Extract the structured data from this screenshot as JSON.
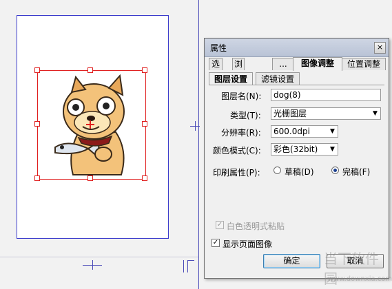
{
  "dialog": {
    "title": "属性",
    "close_symbol": "×",
    "tabs": [
      {
        "label": "选"
      },
      {
        "label": "浏"
      },
      {
        "label": "..."
      },
      {
        "label": "图像调整"
      },
      {
        "label": "位置调整"
      }
    ],
    "subtabs": [
      {
        "label": "图层设置"
      },
      {
        "label": "滤镜设置"
      }
    ],
    "fields": {
      "layer_name_label": "图层名(N):",
      "layer_name_value": "dog(8)",
      "type_label": "类型(T):",
      "type_value": "光栅图层",
      "resolution_label": "分辨率(R):",
      "resolution_value": "600.0dpi",
      "color_mode_label": "颜色模式(C):",
      "color_mode_value": "彩色(32bit)",
      "print_label": "印刷属性(P):",
      "print_option_draft": "草稿(D)",
      "print_option_final": "完稿(F)",
      "print_selected": "完稿(F)"
    },
    "checkboxes": {
      "white_transparent_label": "白色透明式粘贴",
      "white_transparent_checked": true,
      "white_transparent_enabled": false,
      "show_page_image_label": "显示页面图像",
      "show_page_image_checked": true
    },
    "buttons": {
      "ok": "确定",
      "cancel": "取消"
    }
  },
  "watermark": {
    "text": "当下软件园",
    "url": "www.downxia.com"
  },
  "colors": {
    "selection": "#e02020",
    "page_border": "#3c3ccc",
    "dog_body": "#f3c27a"
  }
}
